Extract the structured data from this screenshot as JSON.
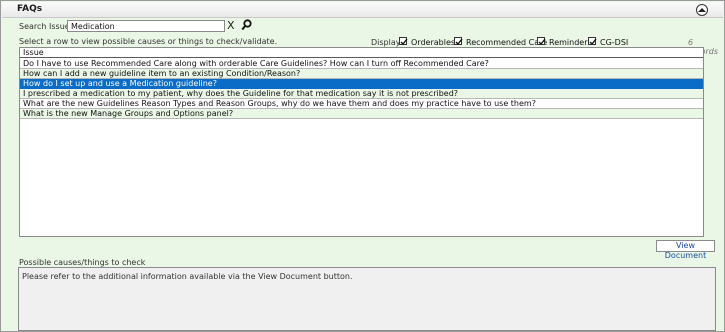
{
  "header": {
    "title": "FAQs",
    "collapse_icon": "chevron-up-icon"
  },
  "search": {
    "label": "Search Issues:",
    "value": "Medication",
    "clear_glyph": "X",
    "search_icon": "magnifier-icon"
  },
  "instruction": "Select a row to view possible causes or things to check/validate.",
  "display": {
    "label": "Display:",
    "options": [
      {
        "label": "Orderables",
        "checked": true
      },
      {
        "label": "Recommended Care",
        "checked": true
      },
      {
        "label": "Reminders",
        "checked": true
      },
      {
        "label": "CG-DSI",
        "checked": true
      }
    ]
  },
  "records": "6 records",
  "table": {
    "column": "Issue",
    "rows": [
      "Do I have to use Recommended Care along with orderable Care Guidelines? How can I turn off Recommended Care?",
      "How can I add a new guideline item to an existing Condition/Reason?",
      "How do I set up and use a Medication guideline?",
      "I prescribed a medication to my patient, why does the Guideline for that medication say it is not prescribed?",
      "What are the new Guidelines Reason Types and Reason Groups, why do we have them and does my practice have to use them?",
      "What is the new Manage Groups and Options panel?"
    ],
    "selected_index": 2
  },
  "view_document_label": "View Document",
  "causes": {
    "label": "Possible causes/things to check",
    "text": "Please refer to the additional information available via the View Document button."
  },
  "colors": {
    "selection": "#0b6cc7",
    "panel_bg": "#eaf6e6",
    "alt_row": "#eaf6e6"
  }
}
